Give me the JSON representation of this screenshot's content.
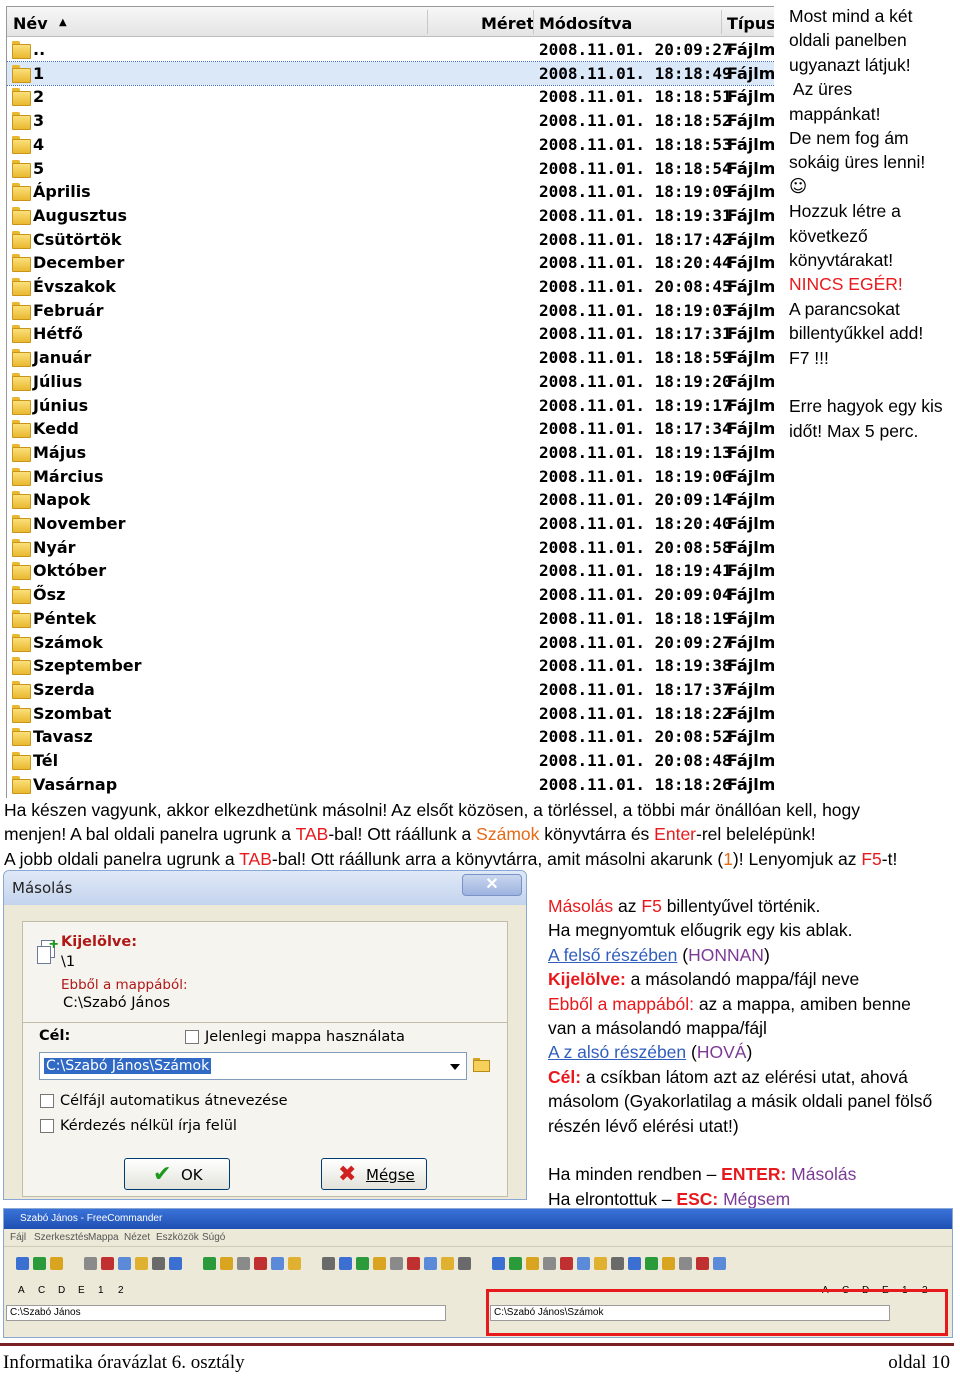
{
  "filelist": {
    "columns": {
      "name": "Név",
      "sort_arrow": "▲",
      "size": "Méret",
      "modified": "Módosítva",
      "type": "Típus"
    },
    "rows": [
      {
        "name": "..",
        "date": "2008.11.01. 20:09:27",
        "type": "Fájlm"
      },
      {
        "name": "1",
        "date": "2008.11.01. 18:18:49",
        "type": "Fájlm"
      },
      {
        "name": "2",
        "date": "2008.11.01. 18:18:51",
        "type": "Fájlm"
      },
      {
        "name": "3",
        "date": "2008.11.01. 18:18:52",
        "type": "Fájlm"
      },
      {
        "name": "4",
        "date": "2008.11.01. 18:18:53",
        "type": "Fájlm"
      },
      {
        "name": "5",
        "date": "2008.11.01. 18:18:54",
        "type": "Fájlm"
      },
      {
        "name": "Április",
        "date": "2008.11.01. 18:19:09",
        "type": "Fájlm"
      },
      {
        "name": "Augusztus",
        "date": "2008.11.01. 18:19:31",
        "type": "Fájlm"
      },
      {
        "name": "Csütörtök",
        "date": "2008.11.01. 18:17:42",
        "type": "Fájlm"
      },
      {
        "name": "December",
        "date": "2008.11.01. 18:20:44",
        "type": "Fájlm"
      },
      {
        "name": "Évszakok",
        "date": "2008.11.01. 20:08:45",
        "type": "Fájlm"
      },
      {
        "name": "Február",
        "date": "2008.11.01. 18:19:03",
        "type": "Fájlm"
      },
      {
        "name": "Hétfő",
        "date": "2008.11.01. 18:17:31",
        "type": "Fájlm"
      },
      {
        "name": "Január",
        "date": "2008.11.01. 18:18:59",
        "type": "Fájlm"
      },
      {
        "name": "Július",
        "date": "2008.11.01. 18:19:20",
        "type": "Fájlm"
      },
      {
        "name": "Június",
        "date": "2008.11.01. 18:19:17",
        "type": "Fájlm"
      },
      {
        "name": "Kedd",
        "date": "2008.11.01. 18:17:34",
        "type": "Fájlm"
      },
      {
        "name": "Május",
        "date": "2008.11.01. 18:19:13",
        "type": "Fájlm"
      },
      {
        "name": "Március",
        "date": "2008.11.01. 18:19:06",
        "type": "Fájlm"
      },
      {
        "name": "Napok",
        "date": "2008.11.01. 20:09:14",
        "type": "Fájlm"
      },
      {
        "name": "November",
        "date": "2008.11.01. 18:20:40",
        "type": "Fájlm"
      },
      {
        "name": "Nyár",
        "date": "2008.11.01. 20:08:58",
        "type": "Fájlm"
      },
      {
        "name": "Október",
        "date": "2008.11.01. 18:19:41",
        "type": "Fájlm"
      },
      {
        "name": "Ősz",
        "date": "2008.11.01. 20:09:04",
        "type": "Fájlm"
      },
      {
        "name": "Péntek",
        "date": "2008.11.01. 18:18:19",
        "type": "Fájlm"
      },
      {
        "name": "Számok",
        "date": "2008.11.01. 20:09:27",
        "type": "Fájlm"
      },
      {
        "name": "Szeptember",
        "date": "2008.11.01. 18:19:38",
        "type": "Fájlm"
      },
      {
        "name": "Szerda",
        "date": "2008.11.01. 18:17:37",
        "type": "Fájlm"
      },
      {
        "name": "Szombat",
        "date": "2008.11.01. 18:18:22",
        "type": "Fájlm"
      },
      {
        "name": "Tavasz",
        "date": "2008.11.01. 20:08:52",
        "type": "Fájlm"
      },
      {
        "name": "Tél",
        "date": "2008.11.01. 20:08:48",
        "type": "Fájlm"
      },
      {
        "name": "Vasárnap",
        "date": "2008.11.01. 18:18:26",
        "type": "Fájlm"
      }
    ],
    "selected_row": "1"
  },
  "notes": {
    "l1": "Most mind a két",
    "l2": "oldali panelben",
    "l3": "ugyanazt látjuk!",
    "l4": " Az üres",
    "l5": "mappánkat!",
    "l6": "De nem fog ám",
    "l7": "sokáig üres lenni!",
    "l8": "☺",
    "l9": "Hozzuk létre a",
    "l10": "következő",
    "l11": "könyvtárakat!",
    "l12": "NINCS EGÉR!",
    "l13": "A parancsokat",
    "l14": "billentyűkkel add!",
    "l15": "F7 !!!",
    "l16": "Erre hagyok egy kis",
    "l17": "időt! Max 5 perc."
  },
  "para": {
    "a": "Ha készen vagyunk, akkor elkezdhetünk másolni! Az elsőt közösen, a törléssel, a többi már önállóan kell, hogy",
    "b1": "menjen! A bal oldali panelra ugrunk a ",
    "b2": "TAB",
    "b3": "-bal! Ott ráállunk a ",
    "b4": "Számok",
    "b5": " könyvtárra és ",
    "b6": "Enter",
    "b7": "-rel belelépünk!",
    "c1": "A jobb oldali panelra ugrunk a ",
    "c2": "TAB",
    "c3": "-bal! Ott ráállunk arra a könyvtárra, amit másolni akarunk (",
    "c4": "1",
    "c5": ")! Lenyomjuk az ",
    "c6": "F5",
    "c7": "-t!"
  },
  "dialog": {
    "title": "Másolás",
    "close": "✕",
    "selected_label": "Kijelölve:",
    "selected_value": "\\1",
    "from_label": "Ebből a mappából:",
    "from_value": "C:\\Szabó János",
    "target_label": "Cél:",
    "use_current": "Jelenlegi mappa használata",
    "target_value": "C:\\Szabó János\\Számok",
    "auto_rename": "Célfájl automatikus átnevezése",
    "no_prompt": "Kérdezés nélkül írja felül",
    "ok": "OK",
    "cancel": "Mégse"
  },
  "explain": {
    "e1a": "Másolás",
    "e1b": " az ",
    "e1c": "F5",
    "e1d": " billentyűvel történik.",
    "e2": "Ha megnyomtuk előugrik egy kis ablak.",
    "e3a": "A felső részében",
    "e3b": " (",
    "e3c": "HONNAN",
    "e3d": ")",
    "e4a": "Kijelölve:",
    "e4b": " a másolandó mappa/fájl neve",
    "e5a": "Ebből a mappából:",
    "e5b": " az a mappa, amiben benne",
    "e6": "van a másolandó mappa/fájl",
    "e7a": "A z alsó részében",
    "e7b": " (",
    "e7c": "HOVÁ",
    "e7d": ")",
    "e8a": "Cél:",
    "e8b": " a csíkban látom azt az elérési utat, ahová",
    "e9": "másolom (Gyakorlatilag a másik oldali panel fölső",
    "e10": "részén lévő elérési utat!)",
    "e11a": "Ha minden rendben – ",
    "e11b": "ENTER:",
    "e11c": " Másolás",
    "e12a": "Ha elrontottuk – ",
    "e12b": "ESC:",
    "e12c": " Mégsem"
  },
  "fc": {
    "title": "Szabó János - FreeCommander",
    "menu": [
      "Fájl",
      "Szerkesztés",
      "Mappa",
      "Nézet",
      "Eszközök",
      "Súgó"
    ],
    "left_path": "C:\\Szabó János",
    "right_path": "C:\\Szabó János\\Számok",
    "drives_left": [
      "A",
      "C",
      "D",
      "E",
      "1",
      "2"
    ],
    "drives_right": [
      "A",
      "C",
      "D",
      "E",
      "1",
      "2"
    ]
  },
  "footer": {
    "left": "Informatika óravázlat 6. osztály",
    "right": "oldal 10"
  },
  "colors": {
    "red": "#e8191c",
    "purple": "#7b3a96",
    "orange": "#e36b17",
    "link": "#2f5ebd",
    "selection": "#316ac5"
  }
}
